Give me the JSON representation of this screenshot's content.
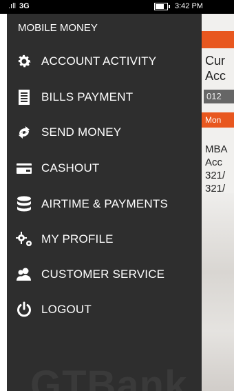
{
  "status_bar": {
    "signal": ".ıll",
    "network": "3G",
    "time": "3:42 PM"
  },
  "drawer": {
    "title": "MOBILE MONEY",
    "watermark": "GTBank",
    "items": [
      {
        "label": "ACCOUNT ACTIVITY",
        "icon": "gear-icon"
      },
      {
        "label": "BILLS PAYMENT",
        "icon": "bill-icon"
      },
      {
        "label": "SEND MONEY",
        "icon": "send-money-icon"
      },
      {
        "label": "CASHOUT",
        "icon": "card-icon"
      },
      {
        "label": "AIRTIME & PAYMENTS",
        "icon": "database-icon"
      },
      {
        "label": "MY PROFILE",
        "icon": "gears-icon"
      },
      {
        "label": "CUSTOMER SERVICE",
        "icon": "users-icon"
      },
      {
        "label": "LOGOUT",
        "icon": "power-icon"
      }
    ]
  },
  "background": {
    "accent": "#e8571f",
    "line1": "Cur",
    "line2": "Acc",
    "number": "012",
    "money_label": "Mon",
    "detail_lines": [
      "MBA",
      "Acc",
      "321/",
      "321/"
    ]
  }
}
